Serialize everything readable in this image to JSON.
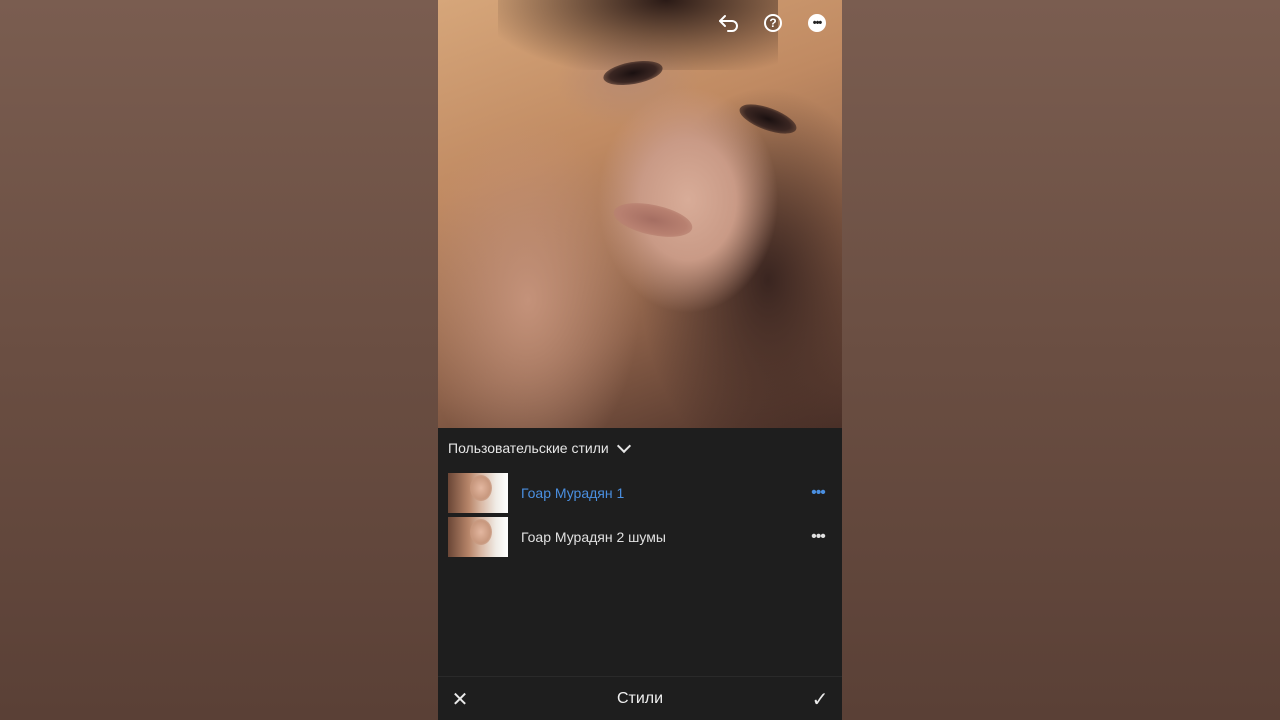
{
  "toolbar": {
    "undo_icon": "undo-icon",
    "help_icon": "help-icon",
    "more_icon": "more-icon"
  },
  "presets_panel": {
    "category_label": "Пользовательские стили",
    "items": [
      {
        "name": "Гоар Мурадян 1",
        "active": true
      },
      {
        "name": "Гоар Мурадян 2 шумы",
        "active": false
      }
    ]
  },
  "bottom_bar": {
    "title": "Стили",
    "cancel_icon": "close-icon",
    "confirm_icon": "check-icon"
  },
  "colors": {
    "accent": "#4a8fe0",
    "panel_bg": "#1e1e1e",
    "text": "#e0e0e0"
  }
}
